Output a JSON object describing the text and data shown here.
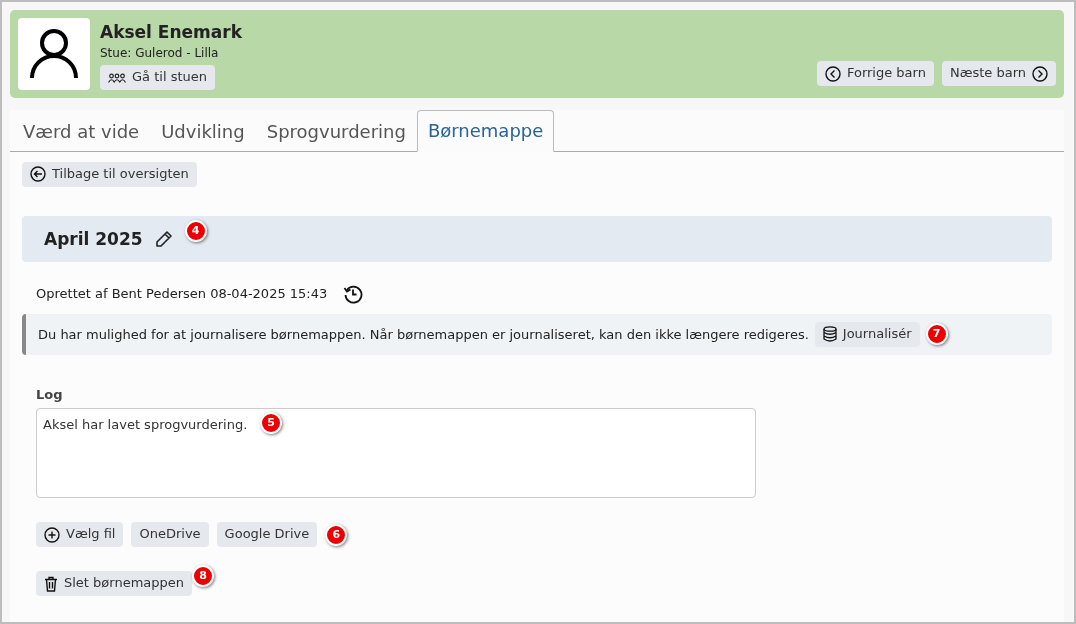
{
  "header": {
    "name": "Aksel Enemark",
    "room": "Stue: Gulerod - Lilla",
    "room_button": "Gå til stuen",
    "prev_button": "Forrige barn",
    "next_button": "Næste barn"
  },
  "tabs": [
    {
      "label": "Værd at vide",
      "selected": false
    },
    {
      "label": "Udvikling",
      "selected": false
    },
    {
      "label": "Sprogvurdering",
      "selected": false
    },
    {
      "label": "Børnemappe",
      "selected": true
    }
  ],
  "back_button": "Tilbage til oversigten",
  "folder": {
    "title": "April 2025",
    "title_callout": "4",
    "created": "Oprettet af Bent Pedersen 08-04-2025 15:43",
    "notice": {
      "text": "Du har mulighed for at journalisere børnemappen. Når børnemappen er journaliseret, kan den ikke længere redigeres.",
      "button": "Journalisér",
      "callout": "7"
    },
    "log": {
      "label": "Log",
      "value": "Aksel har lavet sprogvurdering.",
      "callout": "5"
    },
    "file_buttons": [
      {
        "label": "Vælg fil",
        "kind": "add"
      },
      {
        "label": "OneDrive",
        "kind": "plain"
      },
      {
        "label": "Google Drive",
        "kind": "plain"
      }
    ],
    "file_callout": "6",
    "delete_button": "Slet børnemappen",
    "delete_callout": "8"
  }
}
